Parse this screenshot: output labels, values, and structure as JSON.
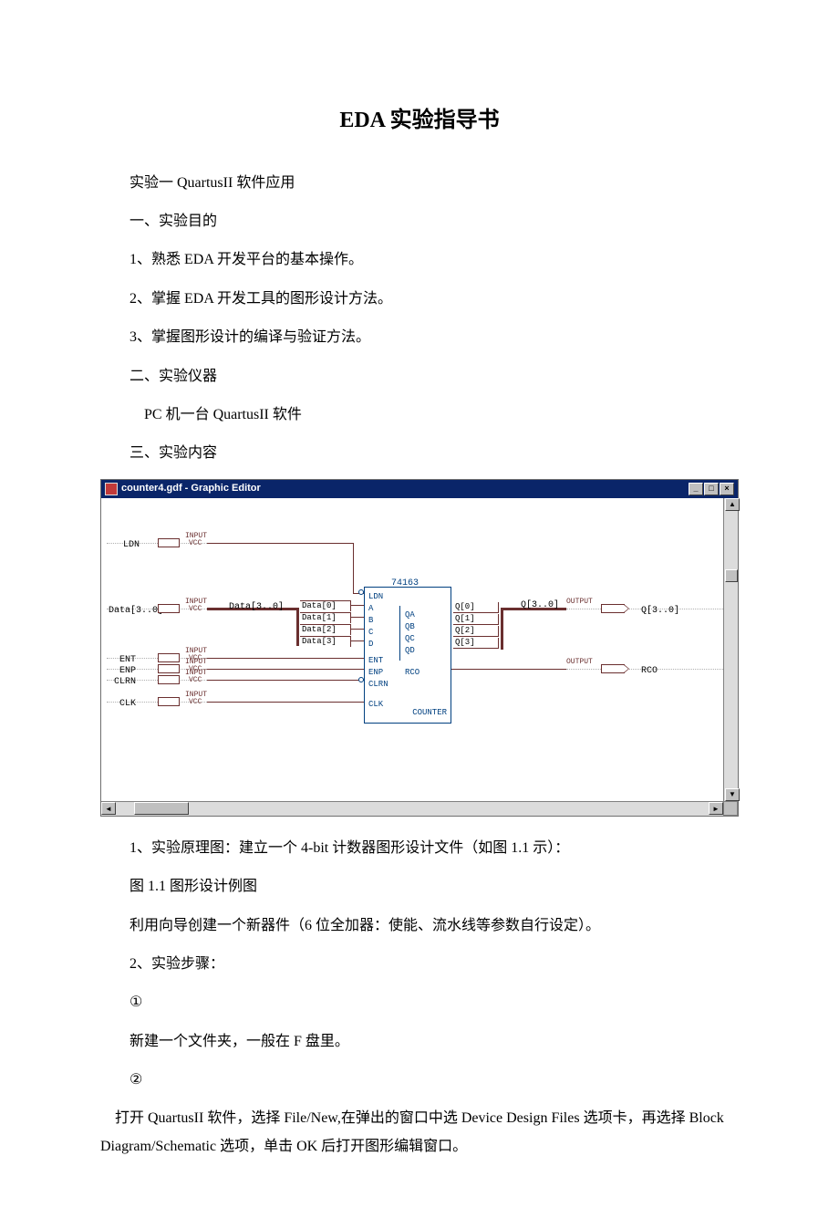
{
  "title": "EDA 实验指导书",
  "lines": {
    "l1": "实验一 QuartusII 软件应用",
    "l2": "一、实验目的",
    "l3": "1、熟悉 EDA 开发平台的基本操作。",
    "l4": "2、掌握 EDA 开发工具的图形设计方法。",
    "l5": "3、掌握图形设计的编译与验证方法。",
    "l6": "二、实验仪器",
    "l7": "PC 机一台    QuartusII    软件",
    "l8": "三、实验内容",
    "l9": "1、实验原理图：建立一个 4-bit 计数器图形设计文件（如图 1.1 示）：",
    "l10": "图 1.1 图形设计例图",
    "l11": "利用向导创建一个新器件（6 位全加器：使能、流水线等参数自行设定）。",
    "l12": "2、实验步骤：",
    "l13": "①",
    "l14": "新建一个文件夹，一般在 F 盘里。",
    "l15": "②",
    "l16": "打开 QuartusII 软件，选择 File/New,在弹出的窗口中选 Device Design Files 选项卡，再选择 Block Diagram/Schematic 选项，单击 OK 后打开图形编辑窗口。"
  },
  "editor": {
    "window_title": "counter4.gdf - Graphic Editor",
    "btn_min": "_",
    "btn_max": "□",
    "btn_close": "×",
    "chip_name": "74163",
    "chip_footer": "COUNTER",
    "inputs": {
      "ldn": "LDN",
      "data": "Data[3..0]",
      "ent": "ENT",
      "enp": "ENP",
      "clrn": "CLRN",
      "clk": "CLK"
    },
    "io_input": "INPUT",
    "io_vcc": "VCC",
    "io_output": "OUTPUT",
    "bus_split_label": "Data[3..0]",
    "taps": [
      "Data[0]",
      "Data[1]",
      "Data[2]",
      "Data[3]"
    ],
    "chip_left": [
      "LDN",
      "A",
      "B",
      "C",
      "D",
      "ENT",
      "ENP",
      "CLRN",
      "CLK"
    ],
    "chip_right_q": [
      "QA",
      "QB",
      "QC",
      "QD"
    ],
    "chip_rco": "RCO",
    "q_nets": [
      "Q[0]",
      "Q[1]",
      "Q[2]",
      "Q[3]"
    ],
    "q_bus": "Q[3..0]",
    "out_q": "Q[3..0]",
    "out_rco": "RCO"
  }
}
